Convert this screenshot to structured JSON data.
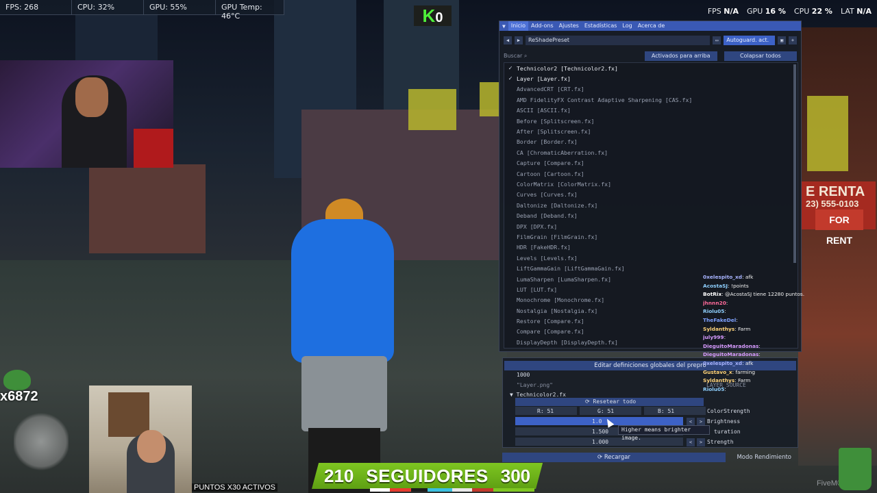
{
  "hud": {
    "fps": "FPS: 268",
    "cpu": "CPU: 32%",
    "gpu": "GPU: 55%",
    "gpu_temp": "GPU Temp: 46°C"
  },
  "overlay_stats": {
    "fps_label": "FPS",
    "fps_value": "N/A",
    "gpu_label": "GPU",
    "gpu_value": "16 %",
    "cpu_label": "CPU",
    "cpu_value": "22 %",
    "lat_label": "LAT",
    "lat_value": "N/A"
  },
  "kbadge": {
    "letter": "K",
    "digit": "0"
  },
  "reshade": {
    "tabs": [
      "Inicio",
      "Add-ons",
      "Ajustes",
      "Estadísticas",
      "Log",
      "Acerca de"
    ],
    "preset_name": "ReShadePreset",
    "autosave": "Autoguard. act.",
    "search_placeholder": "Buscar",
    "btn_active_top": "Activados para arriba",
    "btn_collapse": "Colapsar todos",
    "effects": [
      {
        "name": "Technicolor2 [Technicolor2.fx]",
        "on": true
      },
      {
        "name": "Layer [Layer.fx]",
        "on": true
      },
      {
        "name": "AdvancedCRT [CRT.fx]",
        "on": false
      },
      {
        "name": "AMD FidelityFX Contrast Adaptive Sharpening [CAS.fx]",
        "on": false
      },
      {
        "name": "ASCII [ASCII.fx]",
        "on": false
      },
      {
        "name": "Before [Splitscreen.fx]",
        "on": false
      },
      {
        "name": "After [Splitscreen.fx]",
        "on": false
      },
      {
        "name": "Border [Border.fx]",
        "on": false
      },
      {
        "name": "CA [ChromaticAberration.fx]",
        "on": false
      },
      {
        "name": "Capture [Compare.fx]",
        "on": false
      },
      {
        "name": "Cartoon [Cartoon.fx]",
        "on": false
      },
      {
        "name": "ColorMatrix [ColorMatrix.fx]",
        "on": false
      },
      {
        "name": "Curves [Curves.fx]",
        "on": false
      },
      {
        "name": "Daltonize [Daltonize.fx]",
        "on": false
      },
      {
        "name": "Deband [Deband.fx]",
        "on": false
      },
      {
        "name": "DPX [DPX.fx]",
        "on": false
      },
      {
        "name": "FilmGrain [FilmGrain.fx]",
        "on": false
      },
      {
        "name": "HDR [FakeHDR.fx]",
        "on": false
      },
      {
        "name": "Levels [Levels.fx]",
        "on": false
      },
      {
        "name": "LiftGammaGain [LiftGammaGain.fx]",
        "on": false
      },
      {
        "name": "LumaSharpen [LumaSharpen.fx]",
        "on": false
      },
      {
        "name": "LUT [LUT.fx]",
        "on": false
      },
      {
        "name": "Monochrome [Monochrome.fx]",
        "on": false
      },
      {
        "name": "Nostalgia [Nostalgia.fx]",
        "on": false
      },
      {
        "name": "Restore [Compare.fx]",
        "on": false
      },
      {
        "name": "Compare [Compare.fx]",
        "on": false
      },
      {
        "name": "DisplayDepth [DisplayDepth.fx]",
        "on": false
      }
    ],
    "global_header": "Editar definiciones globales del prepro",
    "value_1000": "1000",
    "layer_png": "\"Layer.png\"",
    "layer_source": "LAYER_SOURCE",
    "section": "Technicolor2.fx",
    "reset": "Resetear todo",
    "r": "R: 51",
    "g": "G: 51",
    "b": "B: 51",
    "color_strength": "ColorStrength",
    "brightness_value": "1.0",
    "brightness": "Brightness",
    "saturation_value": "1.500",
    "saturation": "turation",
    "strength_value": "1.000",
    "strength": "Strength",
    "tooltip": "Higher means brighter image.",
    "reload": "Recargar",
    "perf_mode": "Modo Rendimiento"
  },
  "chat": [
    {
      "user": "0xelespito_xd",
      "msg": ": afk",
      "color": "#a8b4ff"
    },
    {
      "user": "AcostaSJ",
      "msg": ": !points",
      "color": "#8fd0ff"
    },
    {
      "user": "BotRix",
      "msg": ": @AcostaSJ tiene 12280 puntos.",
      "color": "#ffffff"
    },
    {
      "user": "jhnnn20",
      "msg": ":",
      "color": "#ff6a9a"
    },
    {
      "user": "Riolu05",
      "msg": ":",
      "color": "#8fd0ff"
    },
    {
      "user": "TheFakeDel",
      "msg": ":",
      "color": "#7fa2ff"
    },
    {
      "user": "Syldanthys",
      "msg": ": Farm",
      "color": "#ffd37a"
    },
    {
      "user": "july999",
      "msg": ":",
      "color": "#d79bff"
    },
    {
      "user": "DieguitoMaradonas",
      "msg": ":",
      "color": "#d79bff"
    },
    {
      "user": "DieguitoMaradonas",
      "msg": ":",
      "color": "#d79bff"
    },
    {
      "user": "0xelespito_xd",
      "msg": ": afk",
      "color": "#a8b4ff"
    },
    {
      "user": "Gustavo_x",
      "msg": ": farming",
      "color": "#ffd37a"
    },
    {
      "user": "Syldanthys",
      "msg": ": Farm",
      "color": "#ffd37a"
    },
    {
      "user": "Riolu05",
      "msg": ":",
      "color": "#8fd0ff"
    }
  ],
  "sign": {
    "line1": "E RENTA",
    "line2": "23) 555-0103",
    "forrent": "FOR RENT"
  },
  "counter": "x6872",
  "puntos": "PUNTOS X30 ACTIVOS",
  "followers": {
    "current": "210",
    "label": "SEGUIDORES",
    "goal": "300"
  },
  "fivem": "FiveM®"
}
